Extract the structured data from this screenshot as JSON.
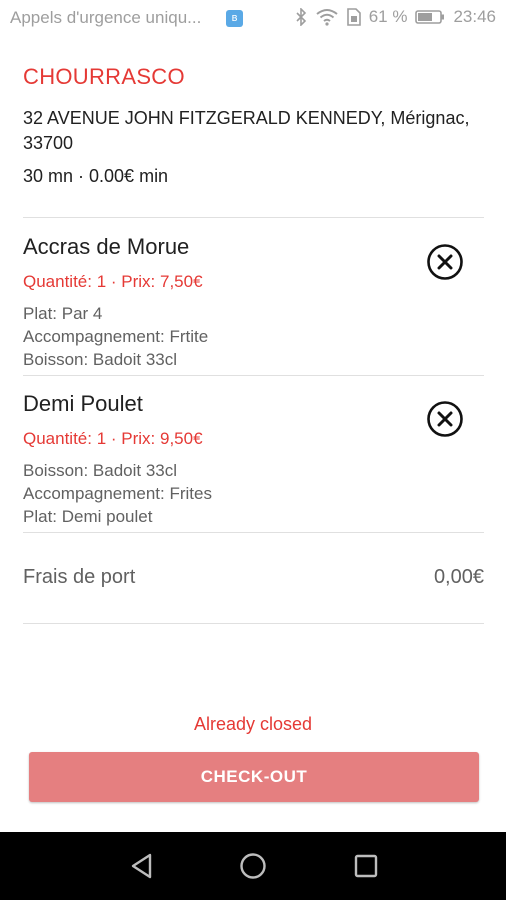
{
  "status_bar": {
    "notification_text": "Appels d'urgence uniqu...",
    "bt_badge_icon": "bluetooth-notification-icon",
    "battery_percent": "61 %",
    "time": "23:46"
  },
  "restaurant": {
    "name": "CHOURRASCO",
    "address": "32 AVENUE JOHN FITZGERALD KENNEDY, Mérignac, 33700",
    "delivery_info": "30 mn · 0.00€ min"
  },
  "cart": {
    "items": [
      {
        "name": "Accras de Morue",
        "qty_price": "Quantité: 1 · Prix: 7,50€",
        "options": [
          "Plat: Par 4",
          "Accompagnement: Frtite",
          "Boisson: Badoit 33cl"
        ],
        "remove_icon": "remove-circle-x-icon"
      },
      {
        "name": "Demi Poulet",
        "qty_price": "Quantité: 1 · Prix: 9,50€",
        "options": [
          "Boisson: Badoit 33cl",
          "Accompagnement: Frites",
          "Plat: Demi poulet"
        ],
        "remove_icon": "remove-circle-x-icon"
      }
    ],
    "shipping_label": "Frais de port",
    "shipping_value": "0,00€"
  },
  "footer": {
    "closed_message": "Already closed",
    "checkout_label": "CHECK-OUT"
  },
  "colors": {
    "accent_red": "#e53935",
    "checkout_disabled": "#e57f80",
    "nav_bar": "#000000"
  },
  "nav_bar": {
    "back_icon": "back-triangle-icon",
    "home_icon": "home-circle-icon",
    "recents_icon": "recents-square-icon"
  }
}
